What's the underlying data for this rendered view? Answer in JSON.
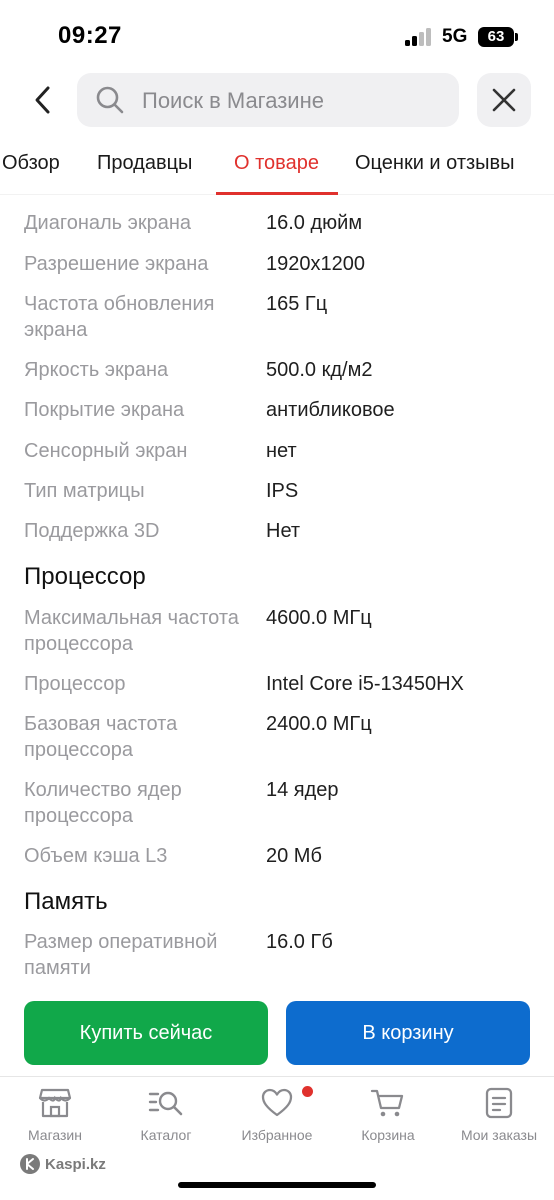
{
  "status": {
    "time": "09:27",
    "network": "5G",
    "battery": "63"
  },
  "search": {
    "placeholder": "Поиск в Магазине"
  },
  "tabs": [
    {
      "label": "Обзор",
      "active": false
    },
    {
      "label": "Продавцы",
      "active": false
    },
    {
      "label": "О товаре",
      "active": true
    },
    {
      "label": "Оценки и отзывы",
      "active": false
    }
  ],
  "specs": {
    "screen": [
      {
        "label": "Диагональ экрана",
        "value": "16.0 дюйм"
      },
      {
        "label": "Разрешение экрана",
        "value": "1920x1200"
      },
      {
        "label": "Частота обновления экрана",
        "value": "165 Гц"
      },
      {
        "label": "Яркость экрана",
        "value": "500.0 кд/м2"
      },
      {
        "label": "Покрытие экрана",
        "value": "антибликовое"
      },
      {
        "label": "Сенсорный экран",
        "value": "нет"
      },
      {
        "label": "Тип матрицы",
        "value": "IPS"
      },
      {
        "label": "Поддержка 3D",
        "value": "Нет"
      }
    ],
    "processor_title": "Процессор",
    "processor": [
      {
        "label": "Максимальная частота процессора",
        "value": "4600.0 МГц"
      },
      {
        "label": "Процессор",
        "value": "Intel Core i5-13450HX"
      },
      {
        "label": "Базовая частота процессора",
        "value": "2400.0 МГц"
      },
      {
        "label": "Количество ядер процессора",
        "value": "14 ядер"
      },
      {
        "label": "Объем кэша L3",
        "value": "20 Мб"
      }
    ],
    "memory_title": "Память",
    "memory": [
      {
        "label": "Размер оперативной памяти",
        "value": "16.0 Гб"
      }
    ]
  },
  "actions": {
    "buy_label": "Купить сейчас",
    "cart_label": "В корзину"
  },
  "nav": [
    {
      "label": "Магазин",
      "icon": "store-icon"
    },
    {
      "label": "Каталог",
      "icon": "catalog-search-icon"
    },
    {
      "label": "Избранное",
      "icon": "heart-icon"
    },
    {
      "label": "Корзина",
      "icon": "cart-icon"
    },
    {
      "label": "Мои заказы",
      "icon": "orders-icon"
    }
  ],
  "brand": {
    "name": "Kaspi.kz"
  },
  "colors": {
    "accent": "#e0312d",
    "buy": "#11a84a",
    "cart": "#0d6cce",
    "muted": "#9a9a9e"
  }
}
